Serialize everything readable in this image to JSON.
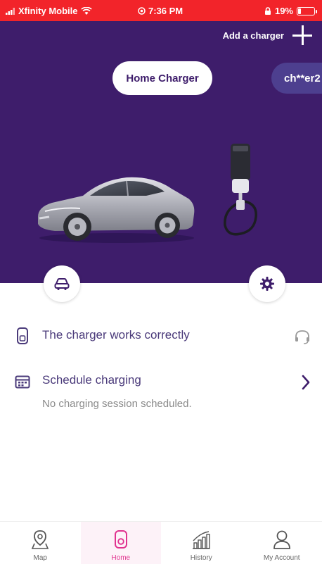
{
  "status_bar": {
    "carrier": "Xfinity Mobile",
    "time": "7:36 PM",
    "battery": "19%",
    "battery_level": 0.19
  },
  "header": {
    "add_charger_label": "Add a charger",
    "charger_tabs": [
      "Home Charger",
      "ch**er2"
    ],
    "active_tab_index": 0
  },
  "hero": {
    "vehicle_icon": "car-icon",
    "settings_icon": "gear-icon"
  },
  "status_row": {
    "text": "The charger works correctly",
    "icon": "charger-icon",
    "action_icon": "headset-icon"
  },
  "schedule_row": {
    "title": "Schedule charging",
    "subtitle": "No charging session scheduled.",
    "icon": "calendar-icon",
    "action_icon": "chevron-right-icon"
  },
  "bottom_nav": {
    "items": [
      {
        "label": "Map",
        "icon": "map-pin-icon"
      },
      {
        "label": "Home",
        "icon": "charger-icon"
      },
      {
        "label": "History",
        "icon": "chart-icon"
      },
      {
        "label": "My Account",
        "icon": "user-icon"
      }
    ],
    "active_index": 1
  },
  "colors": {
    "status_bar": "#f2242a",
    "hero_background": "#3e1d6b",
    "text_purple": "#4a3a7a",
    "accent_pink": "#e0338f"
  }
}
